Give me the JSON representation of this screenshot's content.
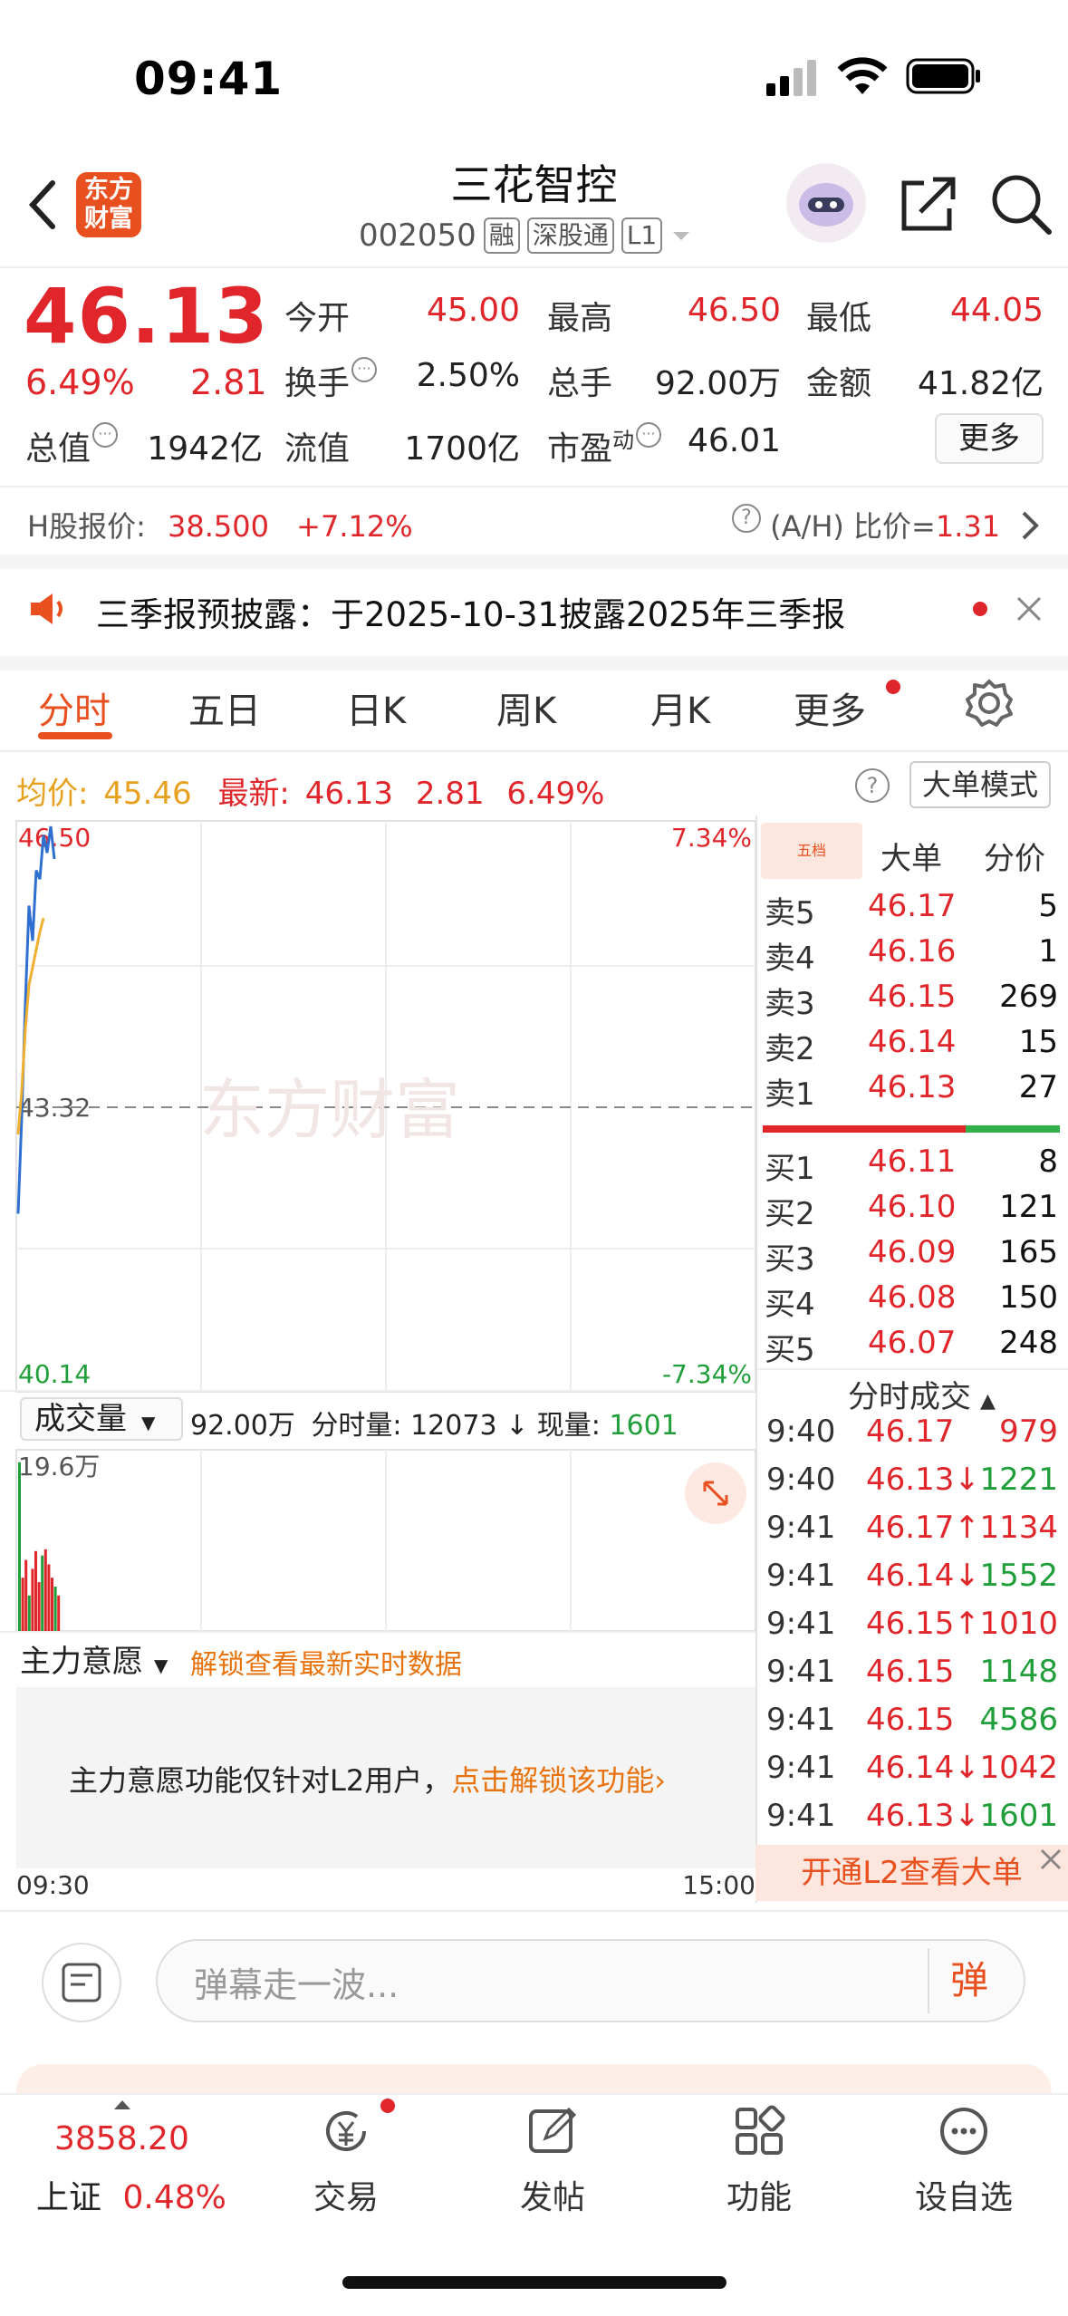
{
  "status_bar": {
    "time": "09:41"
  },
  "header": {
    "logo_text_line1": "东方",
    "logo_text_line2": "财富",
    "name": "三花智控",
    "code": "002050",
    "tags": [
      "融",
      "深股通",
      "L1"
    ]
  },
  "quote": {
    "price": "46.13",
    "change_pct": "6.49%",
    "change": "2.81",
    "open_label": "今开",
    "open": "45.00",
    "high_label": "最高",
    "high": "46.50",
    "low_label": "最低",
    "low": "44.05",
    "turnover_label": "换手",
    "turnover": "2.50%",
    "volume_label": "总手",
    "volume": "92.00万",
    "amount_label": "金额",
    "amount": "41.82亿",
    "mktcap_label": "总值",
    "mktcap": "1942亿",
    "float_label": "流值",
    "float": "1700亿",
    "pe_label": "市盈",
    "pe_sup": "动",
    "pe": "46.01",
    "more_label": "更多"
  },
  "hshare": {
    "label": "H股报价:",
    "price": "38.500",
    "pct": "+7.12%",
    "ratio_label": "(A/H) 比价=",
    "ratio": "1.31"
  },
  "notice": {
    "text": "三季报预披露：于2025-10-31披露2025年三季报"
  },
  "tabs": [
    "分时",
    "五日",
    "日K",
    "周K",
    "月K",
    "更多"
  ],
  "avg_row": {
    "avg_label": "均价:",
    "avg": "45.46",
    "last_label": "最新:",
    "last": "46.13",
    "chg": "2.81",
    "pct": "6.49%",
    "mode_button": "大单模式"
  },
  "chart": {
    "price_high": "46.50",
    "pct_high": "7.34%",
    "price_base": "43.32",
    "price_low": "40.14",
    "pct_low": "-7.34%",
    "time_start": "09:30",
    "time_end": "15:00",
    "watermark": "东方财富",
    "volume_select": "成交量",
    "volume_total": "92.00万",
    "period_vol_label": "分时量:",
    "period_vol": "12073",
    "current_vol_label": "现量:",
    "current_vol": "1601",
    "vol_max": "19.6万",
    "force_select": "主力意愿",
    "force_unlock": "解锁查看最新实时数据",
    "lock_text": "主力意愿功能仅针对L2用户，",
    "lock_link": "点击解锁该功能›"
  },
  "chart_data": {
    "type": "line",
    "series": [
      {
        "values": [
          42.1,
          43.2,
          44.5,
          45.6,
          45.2,
          46.0,
          45.9,
          46.4,
          46.2,
          46.5,
          46.13
        ]
      },
      {
        "values": [
          43.0,
          43.5,
          44.2,
          44.7,
          44.9,
          45.1,
          45.3,
          45.46
        ]
      }
    ],
    "ylim": [
      40.14,
      46.5
    ],
    "baseline": 43.32
  },
  "orderbook": {
    "tabs": [
      "五档",
      "大单",
      "分价"
    ],
    "asks": [
      {
        "label": "卖5",
        "price": "46.17",
        "vol": "5"
      },
      {
        "label": "卖4",
        "price": "46.16",
        "vol": "1"
      },
      {
        "label": "卖3",
        "price": "46.15",
        "vol": "269"
      },
      {
        "label": "卖2",
        "price": "46.14",
        "vol": "15"
      },
      {
        "label": "卖1",
        "price": "46.13",
        "vol": "27"
      }
    ],
    "bids": [
      {
        "label": "买1",
        "price": "46.11",
        "vol": "8"
      },
      {
        "label": "买2",
        "price": "46.10",
        "vol": "121"
      },
      {
        "label": "买3",
        "price": "46.09",
        "vol": "165"
      },
      {
        "label": "买4",
        "price": "46.08",
        "vol": "150"
      },
      {
        "label": "买5",
        "price": "46.07",
        "vol": "248"
      }
    ],
    "ticks_title": "分时成交",
    "ticks": [
      {
        "time": "9:40",
        "price": "46.17",
        "arrow": "",
        "vol": "979",
        "color": "red"
      },
      {
        "time": "9:40",
        "price": "46.13",
        "arrow": "↓",
        "vol": "1221",
        "color": "green"
      },
      {
        "time": "9:41",
        "price": "46.17",
        "arrow": "↑",
        "vol": "1134",
        "color": "red"
      },
      {
        "time": "9:41",
        "price": "46.14",
        "arrow": "↓",
        "vol": "1552",
        "color": "green"
      },
      {
        "time": "9:41",
        "price": "46.15",
        "arrow": "↑",
        "vol": "1010",
        "color": "red"
      },
      {
        "time": "9:41",
        "price": "46.15",
        "arrow": "",
        "vol": "1148",
        "color": "green"
      },
      {
        "time": "9:41",
        "price": "46.15",
        "arrow": "",
        "vol": "4586",
        "color": "green"
      },
      {
        "time": "9:41",
        "price": "46.14",
        "arrow": "↓",
        "vol": "1042",
        "color": "red"
      },
      {
        "time": "9:41",
        "price": "46.13",
        "arrow": "↓",
        "vol": "1601",
        "color": "green"
      }
    ],
    "promo": "开通L2查看大单"
  },
  "comment": {
    "placeholder": "弹幕走一波...",
    "danmu": "弹"
  },
  "bottom_nav": {
    "index_value": "3858.20",
    "index_name": "上证",
    "index_pct": "0.48%",
    "items": [
      "交易",
      "发帖",
      "功能",
      "设自选"
    ]
  }
}
